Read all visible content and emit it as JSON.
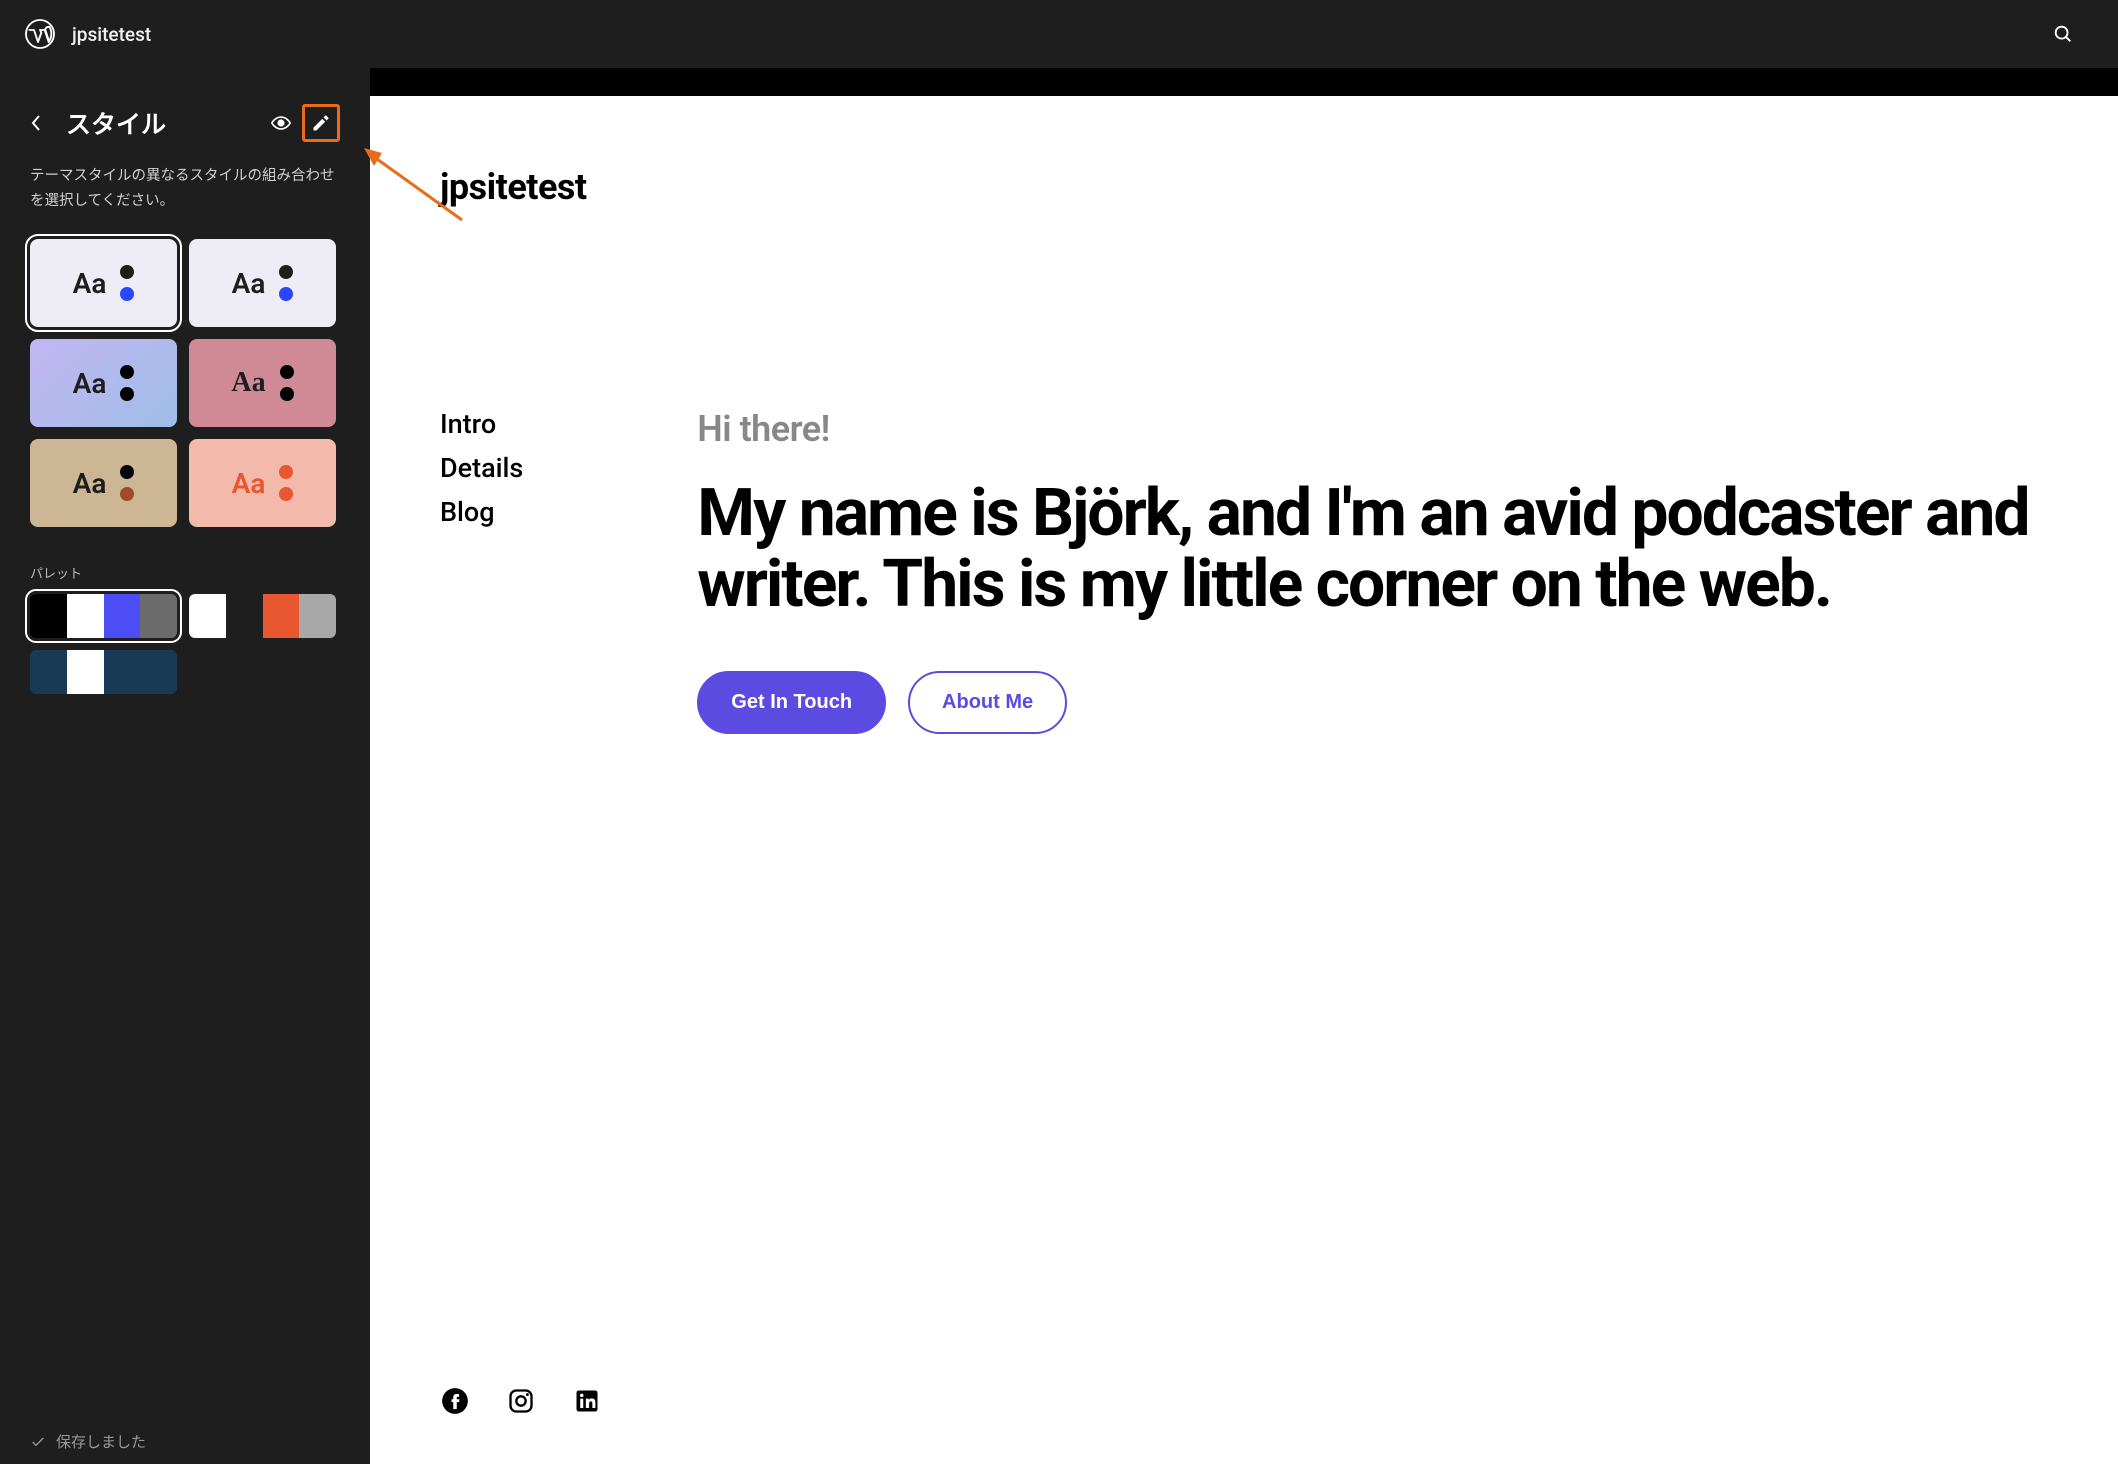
{
  "topbar": {
    "site_name": "jpsitetest"
  },
  "sidebar": {
    "title": "スタイル",
    "description": "テーマスタイルの異なるスタイルの組み合わせを選択してください。",
    "style_cards": [
      {
        "bg": "#eeedf5",
        "aa_color": "#1e1e1e",
        "dot1": "#1e1e1e",
        "dot2": "#2b46ff",
        "aa_serif": false,
        "selected": true
      },
      {
        "bg": "#eeedf5",
        "aa_color": "#1e1e1e",
        "dot1": "#1e1e1e",
        "dot2": "#2b46ff",
        "aa_serif": false,
        "selected": false
      },
      {
        "bg": "linear-gradient(135deg,#c3b6f2 0%,#9fbde8 100%)",
        "aa_color": "#1e1e1e",
        "dot1": "#000",
        "dot2": "#000",
        "aa_serif": false,
        "selected": false
      },
      {
        "bg": "#d08a97",
        "aa_color": "#1e1e1e",
        "dot1": "#000",
        "dot2": "#000",
        "aa_serif": true,
        "selected": false
      },
      {
        "bg": "#cdb693",
        "aa_color": "#1e1e1e",
        "dot1": "#000",
        "dot2": "#a04a30",
        "aa_serif": false,
        "selected": false
      },
      {
        "bg": "#f3b9aa",
        "aa_color": "#e8572f",
        "dot1": "#e8572f",
        "dot2": "#e8572f",
        "aa_serif": false,
        "selected": false
      }
    ],
    "palette_label": "パレット",
    "palettes": [
      {
        "swatches": [
          "#000000",
          "#ffffff",
          "#4d4df5",
          "#6b6b6b"
        ],
        "selected": true
      },
      {
        "swatches": [
          "#ffffff",
          "#1e1e1e",
          "#e8572f",
          "#a8a8a8"
        ],
        "selected": false
      },
      {
        "swatches": [
          "#183a54",
          "#ffffff",
          "#183a54",
          "#183a54"
        ],
        "selected": false
      }
    ],
    "saved_status": "保存しました"
  },
  "preview": {
    "site_title": "jpsitetest",
    "nav": [
      "Intro",
      "Details",
      "Blog"
    ],
    "greeting": "Hi there!",
    "headline": "My name is Björk, and I'm an avid podcaster and writer. This is my little corner on the web.",
    "buttons": {
      "primary": "Get In Touch",
      "secondary": "About Me"
    },
    "social_icons": [
      "facebook",
      "instagram",
      "linkedin"
    ]
  }
}
